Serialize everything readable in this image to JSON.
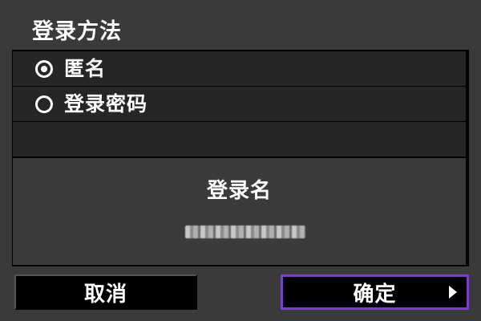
{
  "title": "登录方法",
  "options": [
    {
      "label": "匿名",
      "selected": true
    },
    {
      "label": "登录密码",
      "selected": false
    }
  ],
  "login": {
    "label": "登录名",
    "value": "anonymous"
  },
  "buttons": {
    "cancel": "取消",
    "ok": "确定"
  },
  "colors": {
    "background": "#3a3a3a",
    "panel": "#000000",
    "row": "#262626",
    "focus_border": "#7a3fc7",
    "text": "#ffffff"
  },
  "icons": {
    "radio_selected": "radio-selected-icon",
    "radio_unselected": "radio-unselected-icon",
    "ok_arrow": "arrow-right-icon"
  }
}
